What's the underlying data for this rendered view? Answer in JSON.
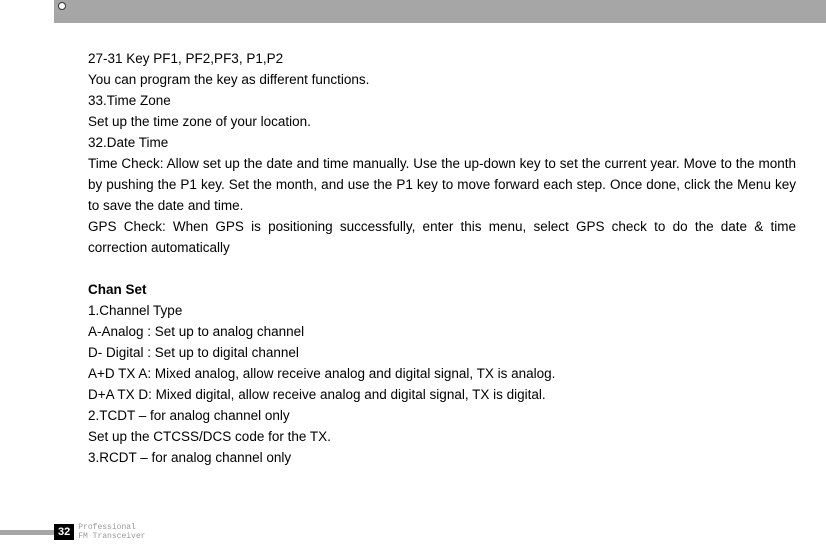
{
  "body": {
    "l1": "27-31 Key PF1, PF2,PF3, P1,P2",
    "l2": "You can program the key as different functions.",
    "l3": "33.Time Zone",
    "l4": "Set up the time zone of your location.",
    "l5": "32.Date Time",
    "l6": "Time Check: Allow set up the date and time manually. Use the up-down key to set the current year. Move to the month by pushing the P1 key. Set the month, and use the P1 key to move forward each step. Once done, click the Menu key to save the date and time.",
    "l7": "GPS Check: When GPS is positioning successfully, enter this menu, select GPS check to do the date & time correction automatically",
    "h1": "Chan Set",
    "l8": "1.Channel Type",
    "l9": "A-Analog : Set up to analog channel",
    "l10": "D- Digital : Set up to digital channel",
    "l11": "A+D TX A: Mixed analog, allow receive analog and digital signal, TX is analog.",
    "l12": "D+A TX D: Mixed digital, allow receive analog and digital signal, TX is digital.",
    "l13": "2.TCDT – for analog channel only",
    "l14": "Set up the CTCSS/DCS code for the TX.",
    "l15": "3.RCDT – for analog channel only"
  },
  "footer": {
    "page": "32",
    "line1": "Professional",
    "line2": "FM Transceiver"
  }
}
